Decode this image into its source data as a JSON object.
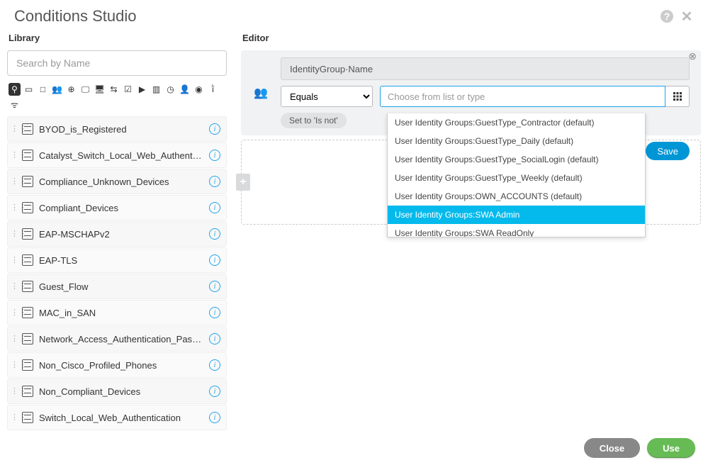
{
  "title": "Conditions Studio",
  "library": {
    "title": "Library",
    "search_placeholder": "Search by Name",
    "items": [
      {
        "label": "BYOD_is_Registered"
      },
      {
        "label": "Catalyst_Switch_Local_Web_Authentication"
      },
      {
        "label": "Compliance_Unknown_Devices"
      },
      {
        "label": "Compliant_Devices"
      },
      {
        "label": "EAP-MSCHAPv2"
      },
      {
        "label": "EAP-TLS"
      },
      {
        "label": "Guest_Flow"
      },
      {
        "label": "MAC_in_SAN"
      },
      {
        "label": "Network_Access_Authentication_Passed"
      },
      {
        "label": "Non_Cisco_Profiled_Phones"
      },
      {
        "label": "Non_Compliant_Devices"
      },
      {
        "label": "Switch_Local_Web_Authentication"
      }
    ]
  },
  "editor": {
    "title": "Editor",
    "attribute": "IdentityGroup·Name",
    "operator": "Equals",
    "value_placeholder": "Choose from list or type",
    "set_not_label": "Set to 'Is not'",
    "save_label": "Save",
    "dropdown": [
      {
        "label": "User Identity Groups:GuestType_Contractor (default)",
        "selected": false
      },
      {
        "label": "User Identity Groups:GuestType_Daily (default)",
        "selected": false
      },
      {
        "label": "User Identity Groups:GuestType_SocialLogin (default)",
        "selected": false
      },
      {
        "label": "User Identity Groups:GuestType_Weekly (default)",
        "selected": false
      },
      {
        "label": "User Identity Groups:OWN_ACCOUNTS (default)",
        "selected": false
      },
      {
        "label": "User Identity Groups:SWA Admin",
        "selected": true
      },
      {
        "label": "User Identity Groups:SWA ReadOnly",
        "selected": false
      }
    ]
  },
  "footer": {
    "close_label": "Close",
    "use_label": "Use"
  }
}
